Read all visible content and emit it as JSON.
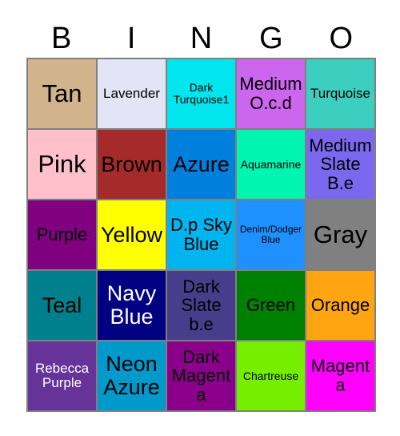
{
  "card": {
    "title_letters": [
      "B",
      "I",
      "N",
      "G",
      "O"
    ],
    "grid_border_color": "#808080",
    "background_color": "#ffffff",
    "columns": 5,
    "rows": 5,
    "cells": [
      {
        "label": "Tan",
        "color": "#D2B48C",
        "text_color": "#000000",
        "size": "fs-xl"
      },
      {
        "label": "Lavender",
        "color": "#E3E4F5",
        "text_color": "#000000",
        "size": "fs-sm"
      },
      {
        "label": "Dark Turquoise1",
        "color": "#00E5EE",
        "text_color": "#000000",
        "size": "fs-xs"
      },
      {
        "label": "Medium O.c.d",
        "color": "#C munch",
        "text_color": "#000000",
        "size": "fs-md"
      },
      {
        "label": "Turquoise",
        "color": "#3CCFC0",
        "text_color": "#000000",
        "size": "fs-sm"
      },
      {
        "label": "Pink",
        "color": "#FFC0CB",
        "text_color": "#000000",
        "size": "fs-xl"
      },
      {
        "label": "Brown",
        "color": "#A52A2A",
        "text_color": "#000000",
        "size": "fs-lg"
      },
      {
        "label": "Azure",
        "color": "#0080DD",
        "text_color": "#000000",
        "size": "fs-lg"
      },
      {
        "label": "Aquamarine",
        "color": "#00F5B0",
        "text_color": "#000000",
        "size": "fs-xs"
      },
      {
        "label": "Medium Slate B.e",
        "color": "#7B68EE",
        "text_color": "#000000",
        "size": "fs-md"
      },
      {
        "label": "Purple",
        "color": "#800080",
        "text_color": "#000000",
        "size": "fs-md"
      },
      {
        "label": "Yellow",
        "color": "#FFFF00",
        "text_color": "#000000",
        "size": "fs-lg"
      },
      {
        "label": "D.p Sky Blue",
        "color": "#00B4EF",
        "text_color": "#000000",
        "size": "fs-md"
      },
      {
        "label": "Denim/Dodger Blue",
        "color": "#1E90FF",
        "text_color": "#000000",
        "size": "fs-xxs"
      },
      {
        "label": "Gray",
        "color": "#808080",
        "text_color": "#000000",
        "size": "fs-xl"
      },
      {
        "label": "Teal",
        "color": "#00808C",
        "text_color": "#000000",
        "size": "fs-lg"
      },
      {
        "label": "Navy Blue",
        "color": "#000080",
        "text_color": "#FFFFFF",
        "size": "fs-lg"
      },
      {
        "label": "Dark Slate b.e",
        "color": "#483D8B",
        "text_color": "#000000",
        "size": "fs-md"
      },
      {
        "label": "Green",
        "color": "#008000",
        "text_color": "#000000",
        "size": "fs-md"
      },
      {
        "label": "Orange",
        "color": "#FFA511",
        "text_color": "#000000",
        "size": "fs-md"
      },
      {
        "label": "Rebecca Purple",
        "color": "#663399",
        "text_color": "#FFFFFF",
        "size": "fs-sm"
      },
      {
        "label": "Neon Azure",
        "color": "#0099CC",
        "text_color": "#000000",
        "size": "fs-lg"
      },
      {
        "label": "Dark Magenta",
        "color": "#8B008B",
        "text_color": "#000000",
        "size": "fs-md"
      },
      {
        "label": "Chartreuse",
        "color": "#76EE00",
        "text_color": "#000000",
        "size": "fs-xs"
      },
      {
        "label": "Magenta",
        "color": "#FF00FF",
        "text_color": "#000000",
        "size": "fs-md"
      }
    ]
  }
}
